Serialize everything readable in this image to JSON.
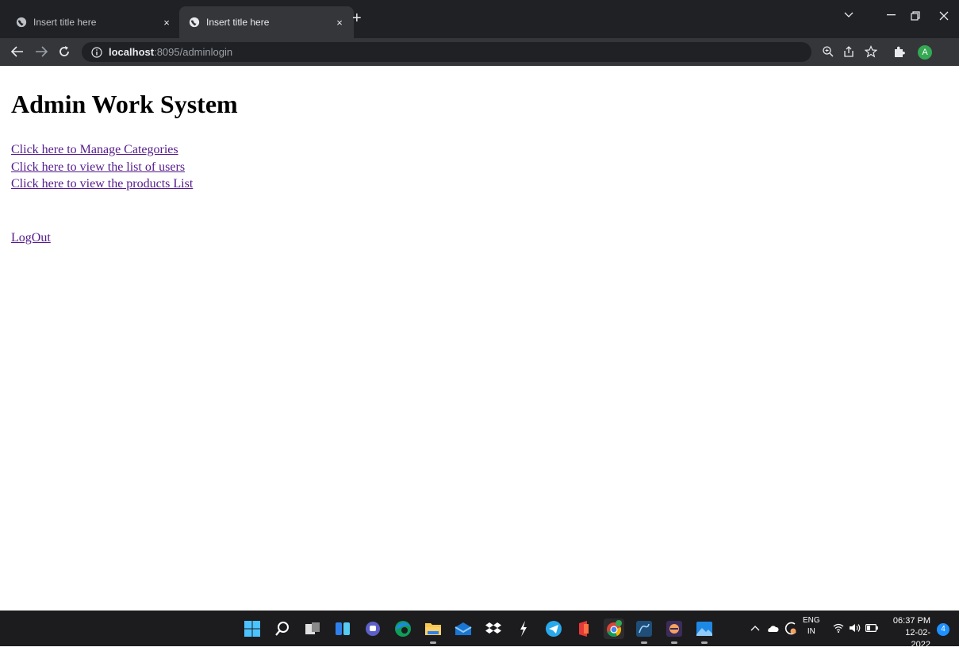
{
  "browser": {
    "tabs": [
      {
        "title": "Insert title here",
        "active": false
      },
      {
        "title": "Insert title here",
        "active": true
      }
    ],
    "new_tab_label": "+",
    "close_label": "×",
    "address": {
      "host": "localhost",
      "path": ":8095/adminlogin"
    }
  },
  "page": {
    "heading": "Admin Work System",
    "links": [
      "Click here to Manage Categories",
      "Click here to view the list of users",
      "Click here to view the products List"
    ],
    "logout_label": "LogOut"
  },
  "taskbar": {
    "language": {
      "line1": "ENG",
      "line2": "IN"
    },
    "time": "06:37 PM",
    "date": "12-02-2022",
    "notification_count": "4"
  },
  "colors": {
    "link_visited": "#551a8b",
    "chrome_dark": "#202124",
    "chrome_toolbar": "#35363a",
    "taskbar": "#1c1c1e",
    "avatar": "#34a853"
  },
  "profile_initial": "A"
}
